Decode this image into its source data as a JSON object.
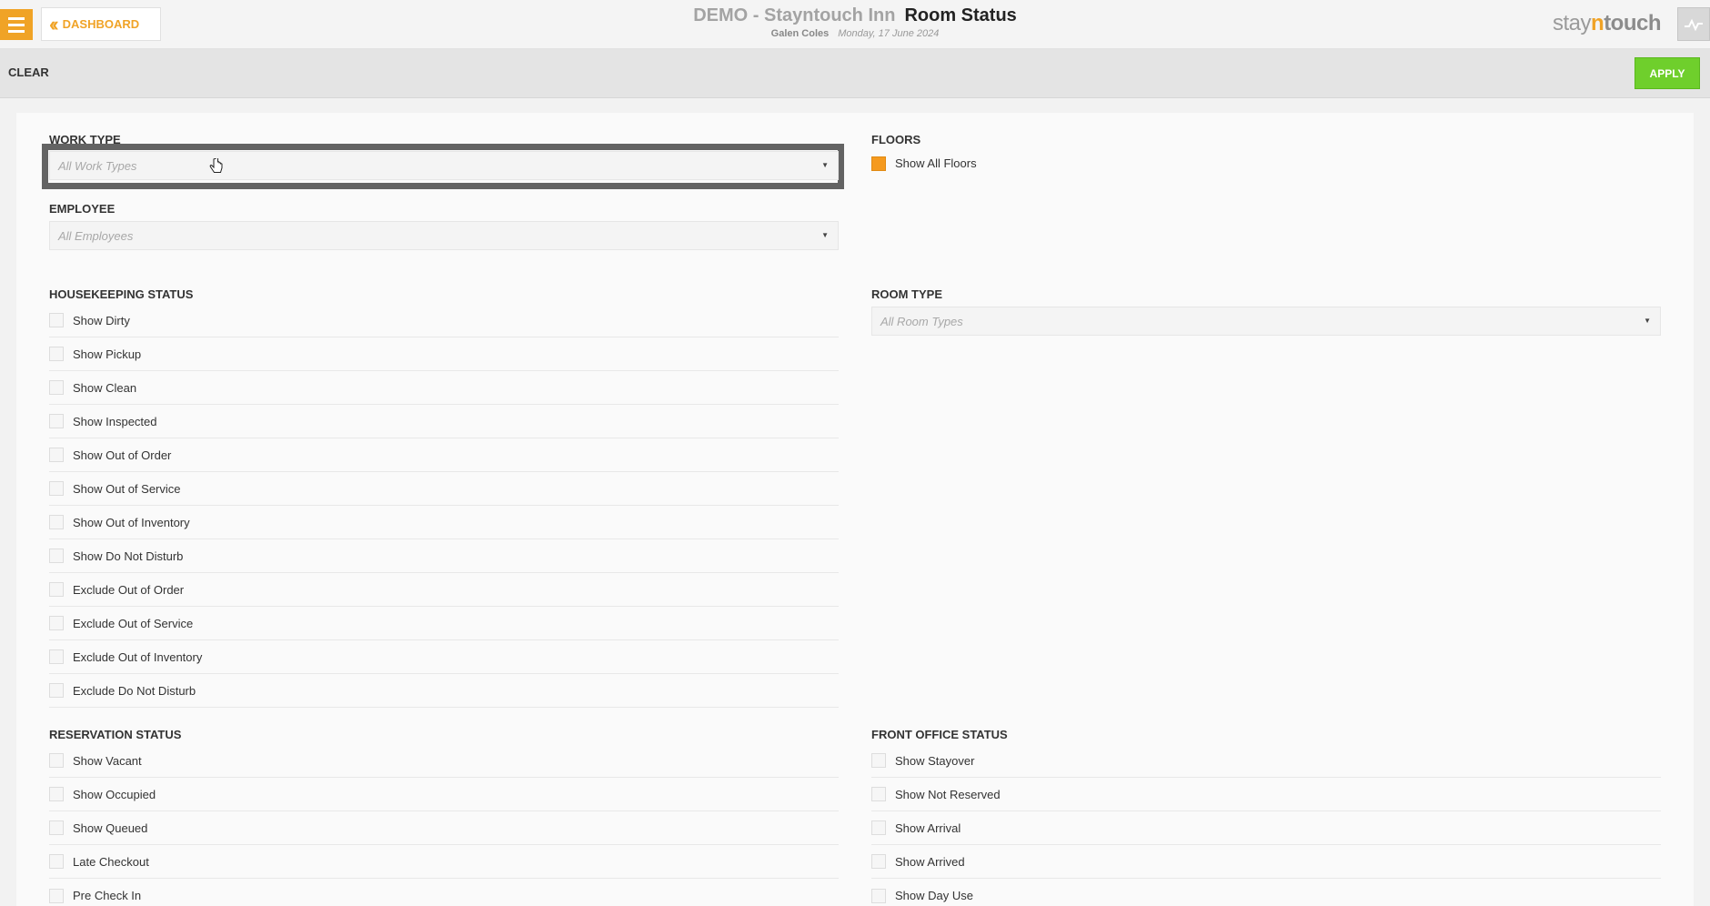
{
  "header": {
    "dashboard_label": "DASHBOARD",
    "hotel": "DEMO - Stayntouch Inn",
    "page_title": "Room Status",
    "user": "Galen Coles",
    "date": "Monday, 17 June 2024",
    "logo_pre": "stay",
    "logo_n": "n",
    "logo_post": "touch",
    "accent_color": "#f0a326"
  },
  "toolbar": {
    "clear_label": "CLEAR",
    "apply_label": "APPLY",
    "apply_color": "#6fcf2c"
  },
  "filters": {
    "work_type": {
      "title": "WORK TYPE",
      "placeholder": "All Work Types"
    },
    "employee": {
      "title": "EMPLOYEE",
      "placeholder": "All Employees"
    },
    "floors": {
      "title": "FLOORS",
      "option": "Show All Floors",
      "checked": true
    },
    "room_type": {
      "title": "ROOM TYPE",
      "placeholder": "All Room Types"
    },
    "housekeeping": {
      "title": "HOUSEKEEPING STATUS",
      "items": [
        "Show Dirty",
        "Show Pickup",
        "Show Clean",
        "Show Inspected",
        "Show Out of Order",
        "Show Out of Service",
        "Show Out of Inventory",
        "Show Do Not Disturb",
        "Exclude Out of Order",
        "Exclude Out of Service",
        "Exclude Out of Inventory",
        "Exclude Do Not Disturb"
      ]
    },
    "reservation": {
      "title": "RESERVATION STATUS",
      "items": [
        "Show Vacant",
        "Show Occupied",
        "Show Queued",
        "Late Checkout",
        "Pre Check In"
      ]
    },
    "front_office": {
      "title": "FRONT OFFICE STATUS",
      "items": [
        "Show Stayover",
        "Show Not Reserved",
        "Show Arrival",
        "Show Arrived",
        "Show Day Use"
      ]
    }
  }
}
